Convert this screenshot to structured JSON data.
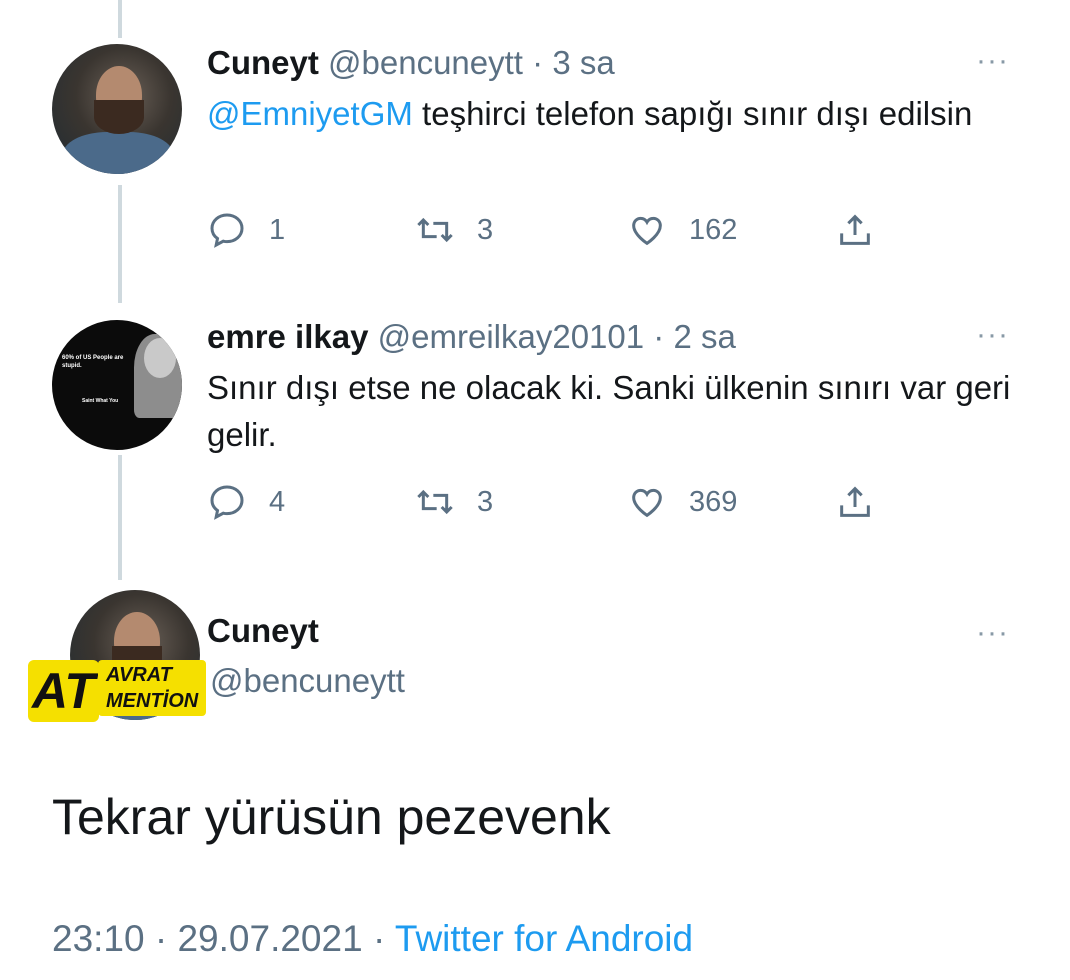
{
  "tweets": [
    {
      "name": "Cuneyt",
      "handle": "@bencuneytt",
      "separator": "·",
      "time": "3 sa",
      "mention": "@EmniyetGM",
      "text": " teşhirci telefon sapığı sınır dışı edilsin",
      "replies": "1",
      "retweets": "3",
      "likes": "162",
      "more": "···"
    },
    {
      "name": "emre ilkay",
      "handle": "@emreilkay20101",
      "separator": "·",
      "time": "2 sa",
      "text": "Sınır dışı etse ne olacak ki. Sanki ülkenin sınırı var geri gelir.",
      "replies": "4",
      "retweets": "3",
      "likes": "369",
      "more": "···",
      "avatar_text_top": "60% of US People are stupid.",
      "avatar_text_bottom": "Saint What You"
    }
  ],
  "main_tweet": {
    "name": "Cuneyt",
    "handle": "@bencuneytt",
    "more": "···",
    "badge_at": "AT",
    "badge_text": "AVRAT MENTİON",
    "text": "Tekrar yürüsün pezevenk",
    "time": "23:10",
    "separator1": "·",
    "date": "29.07.2021",
    "separator2": "·",
    "source": "Twitter for Android"
  },
  "colors": {
    "link": "#1d9bf0",
    "secondary_text": "#5b7083",
    "thread_line": "#cfd9de",
    "badge_yellow": "#f5e000"
  },
  "icons": [
    "reply-icon",
    "retweet-icon",
    "like-icon",
    "share-icon",
    "more-icon"
  ]
}
